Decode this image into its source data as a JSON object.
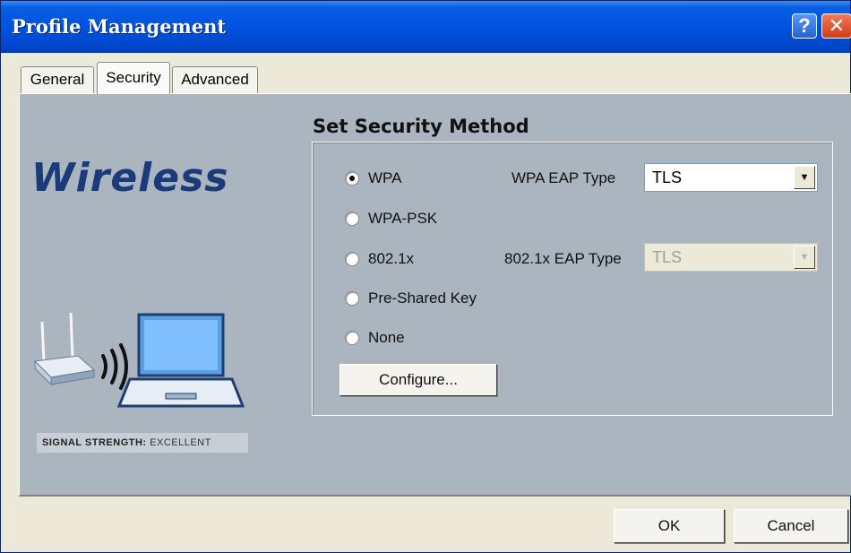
{
  "window": {
    "title": "Profile Management"
  },
  "titlebar": {
    "help_label": "?",
    "close_label": "✕"
  },
  "tabs": [
    {
      "label": "General"
    },
    {
      "label": "Security"
    },
    {
      "label": "Advanced"
    }
  ],
  "banner": {
    "brand": "Wireless",
    "signal_key": "SIGNAL STRENGTH:",
    "signal_value": "EXCELLENT"
  },
  "security": {
    "title": "Set Security Method",
    "options": [
      {
        "label": "WPA",
        "checked": true
      },
      {
        "label": "WPA-PSK",
        "checked": false
      },
      {
        "label": "802.1x",
        "checked": false
      },
      {
        "label": "Pre-Shared Key",
        "checked": false
      },
      {
        "label": "None",
        "checked": false
      }
    ],
    "wpa_eap_label": "WPA EAP Type",
    "wpa_eap_value": "TLS",
    "dot1x_eap_label": "802.1x EAP Type",
    "dot1x_eap_value": "TLS",
    "configure_label": "Configure..."
  },
  "footer": {
    "ok_label": "OK",
    "cancel_label": "Cancel"
  },
  "colors": {
    "titlebar": "#0054e3",
    "panel": "#abb5c0",
    "brand": "#1b3a7a"
  }
}
